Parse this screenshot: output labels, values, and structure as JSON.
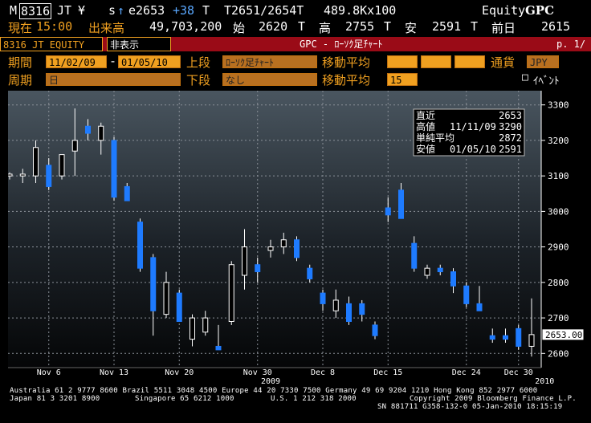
{
  "header": {
    "m": "M",
    "code": "8316",
    "jt": "JT",
    "yen": "¥",
    "s": "s",
    "arrow": "↑",
    "e": "e2653",
    "change": "+38",
    "t1": "T",
    "bidask": "T2651/2654T",
    "size": "489.8Kx100",
    "equity": "Equity",
    "gpc": "GPC"
  },
  "line2": {
    "now_label": "現在",
    "time": "15:00",
    "vol_label": "出来高",
    "volume": "49,703,200",
    "open_label": "始",
    "open": "2620",
    "t_a": "T",
    "high_label": "高",
    "high": "2755",
    "t_b": "T",
    "low_label": "安",
    "low": "2591",
    "t_c": "T",
    "prev_label": "前日",
    "prev": "2615"
  },
  "redbar": {
    "security": "8316 JT EQUITY",
    "hide": "非表示",
    "title": "GPC - ﾛｰｿｸ足ﾁｬｰﾄ",
    "page": "p. 1/"
  },
  "settings": {
    "period_label": "期間",
    "date_from": "11/02/09",
    "dash": "-",
    "date_to": "01/05/10",
    "upper_label": "上段",
    "upper_value": "ﾛｰｿｸ足ﾁｬｰﾄ",
    "ma_label": "移動平均",
    "currency_label": "通貨",
    "currency": "JPY",
    "cycle_label": "周期",
    "cycle_value": "日",
    "lower_label": "下段",
    "lower_value": "なし",
    "ma2_label": "移動平均",
    "ma2_value": "15",
    "event_check": "□",
    "event_label": "ｲﾍﾞﾝﾄ"
  },
  "legend": {
    "recent_label": "直近",
    "recent_value": "2653",
    "high_label": "高値",
    "high_date": "11/11/09",
    "high_value": "3290",
    "sma_label": "単純平均",
    "sma_value": "2872",
    "low_label": "安値",
    "low_date": "01/05/10",
    "low_value": "2591"
  },
  "chart_data": {
    "type": "candlestick",
    "ylim": [
      2560,
      3340
    ],
    "yticks": [
      2600,
      2700,
      2800,
      2900,
      3000,
      3100,
      3200,
      3300
    ],
    "last_price": "2653.00",
    "x_labels": [
      "Nov 6",
      "Nov 13",
      "Nov 20",
      "Nov 30",
      "Dec 8",
      "Dec 15",
      "Dec 24",
      "Dec 30"
    ],
    "x_label_index": [
      3,
      8,
      13,
      19,
      24,
      29,
      35,
      39
    ],
    "year_labels": [
      {
        "text": "2009",
        "index": 20
      },
      {
        "text": "2010",
        "index": 41
      }
    ],
    "candles": [
      {
        "o": 3100,
        "h": 3110,
        "l": 3090,
        "c": 3105
      },
      {
        "o": 3100,
        "h": 3120,
        "l": 3080,
        "c": 3105
      },
      {
        "o": 3100,
        "h": 3200,
        "l": 3080,
        "c": 3180
      },
      {
        "o": 3130,
        "h": 3150,
        "l": 3060,
        "c": 3070
      },
      {
        "o": 3100,
        "h": 3150,
        "l": 3090,
        "c": 3160
      },
      {
        "o": 3170,
        "h": 3290,
        "l": 3100,
        "c": 3200
      },
      {
        "o": 3240,
        "h": 3260,
        "l": 3200,
        "c": 3220
      },
      {
        "o": 3200,
        "h": 3250,
        "l": 3160,
        "c": 3240
      },
      {
        "o": 3200,
        "h": 3210,
        "l": 3030,
        "c": 3040
      },
      {
        "o": 3070,
        "h": 3080,
        "l": 3030,
        "c": 3030
      },
      {
        "o": 2970,
        "h": 2980,
        "l": 2830,
        "c": 2840
      },
      {
        "o": 2870,
        "h": 2880,
        "l": 2650,
        "c": 2720
      },
      {
        "o": 2710,
        "h": 2830,
        "l": 2700,
        "c": 2800
      },
      {
        "o": 2770,
        "h": 2780,
        "l": 2690,
        "c": 2690
      },
      {
        "o": 2640,
        "h": 2710,
        "l": 2620,
        "c": 2700
      },
      {
        "o": 2660,
        "h": 2720,
        "l": 2650,
        "c": 2700
      },
      {
        "o": 2620,
        "h": 2680,
        "l": 2610,
        "c": 2610
      },
      {
        "o": 2690,
        "h": 2860,
        "l": 2680,
        "c": 2850
      },
      {
        "o": 2820,
        "h": 2950,
        "l": 2780,
        "c": 2900
      },
      {
        "o": 2850,
        "h": 2870,
        "l": 2800,
        "c": 2830
      },
      {
        "o": 2890,
        "h": 2920,
        "l": 2870,
        "c": 2900
      },
      {
        "o": 2900,
        "h": 2940,
        "l": 2880,
        "c": 2920
      },
      {
        "o": 2920,
        "h": 2930,
        "l": 2860,
        "c": 2870
      },
      {
        "o": 2840,
        "h": 2850,
        "l": 2800,
        "c": 2810
      },
      {
        "o": 2770,
        "h": 2780,
        "l": 2720,
        "c": 2740
      },
      {
        "o": 2720,
        "h": 2780,
        "l": 2700,
        "c": 2750
      },
      {
        "o": 2740,
        "h": 2760,
        "l": 2680,
        "c": 2690
      },
      {
        "o": 2740,
        "h": 2750,
        "l": 2690,
        "c": 2710
      },
      {
        "o": 2680,
        "h": 2690,
        "l": 2640,
        "c": 2650
      },
      {
        "o": 3010,
        "h": 3040,
        "l": 2970,
        "c": 2990
      },
      {
        "o": 3060,
        "h": 3080,
        "l": 2980,
        "c": 2980
      },
      {
        "o": 2910,
        "h": 2930,
        "l": 2830,
        "c": 2840
      },
      {
        "o": 2820,
        "h": 2850,
        "l": 2810,
        "c": 2840
      },
      {
        "o": 2840,
        "h": 2850,
        "l": 2820,
        "c": 2830
      },
      {
        "o": 2830,
        "h": 2840,
        "l": 2770,
        "c": 2790
      },
      {
        "o": 2790,
        "h": 2800,
        "l": 2730,
        "c": 2740
      },
      {
        "o": 2740,
        "h": 2790,
        "l": 2720,
        "c": 2720
      },
      {
        "o": 2650,
        "h": 2670,
        "l": 2630,
        "c": 2640
      },
      {
        "o": 2650,
        "h": 2670,
        "l": 2630,
        "c": 2640
      },
      {
        "o": 2670,
        "h": 2680,
        "l": 2610,
        "c": 2620
      },
      {
        "o": 2620,
        "h": 2755,
        "l": 2591,
        "c": 2653
      }
    ]
  },
  "footer": {
    "line1": "Australia 61 2 9777 8600 Brazil 5511 3048 4500 Europe 44 20 7330 7500 Germany 49 69 9204 1210 Hong Kong 852 2977 6000",
    "japan": "Japan 81 3 3201 8900",
    "singapore": "Singapore 65 6212 1000",
    "us": "U.S. 1 212 318 2000",
    "copyright": "Copyright 2009 Bloomberg Finance L.P.",
    "sn": "SN 881711 G358-132-0 05-Jan-2010 18:15:19"
  }
}
